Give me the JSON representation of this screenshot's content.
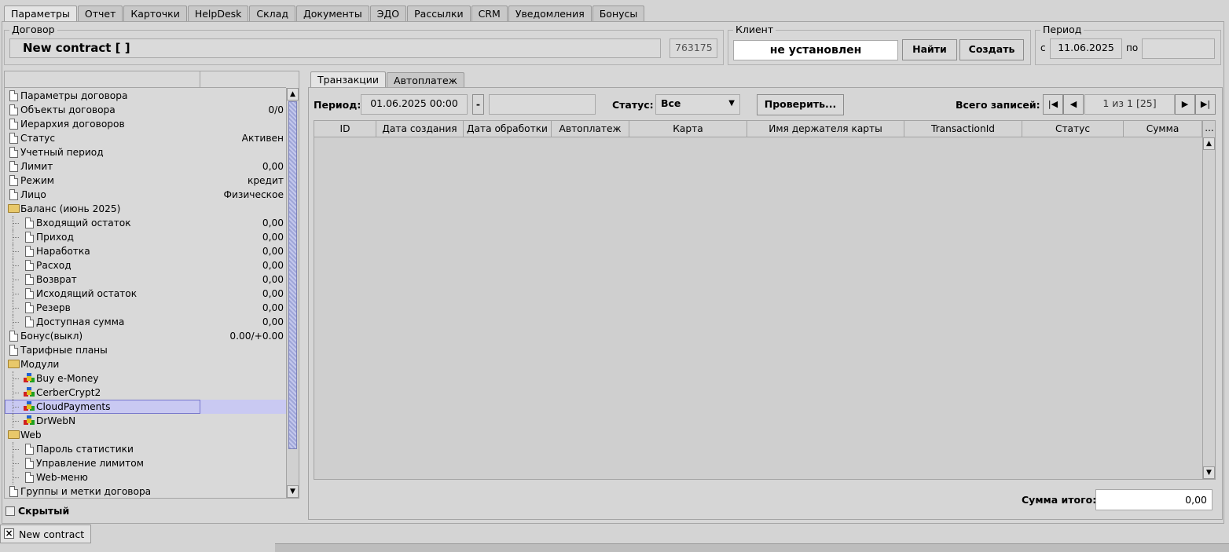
{
  "top_tabs": [
    "Параметры",
    "Отчет",
    "Карточки",
    "HelpDesk",
    "Склад",
    "Документы",
    "ЭДО",
    "Рассылки",
    "CRM",
    "Уведомления",
    "Бонусы"
  ],
  "contract": {
    "group_title": "Договор",
    "name": "New contract [  ]",
    "id": "763175"
  },
  "client": {
    "group_title": "Клиент",
    "value": "не установлен",
    "find_label": "Найти",
    "create_label": "Создать"
  },
  "period": {
    "group_title": "Период",
    "from_label": "с",
    "from_value": "11.06.2025",
    "to_label": "по",
    "to_value": ""
  },
  "tree": {
    "rows": [
      {
        "label": "Параметры договора",
        "value": "",
        "icon": "document-icon",
        "level": 0
      },
      {
        "label": "Объекты договора",
        "value": "0/0",
        "icon": "document-icon",
        "level": 0
      },
      {
        "label": "Иерархия договоров",
        "value": "",
        "icon": "document-icon",
        "level": 0
      },
      {
        "label": "Статус",
        "value": "Активен",
        "icon": "document-icon",
        "level": 0
      },
      {
        "label": "Учетный период",
        "value": "",
        "icon": "document-icon",
        "level": 0
      },
      {
        "label": "Лимит",
        "value": "0,00",
        "icon": "document-icon",
        "level": 0
      },
      {
        "label": "Режим",
        "value": "кредит",
        "icon": "document-icon",
        "level": 0
      },
      {
        "label": "Лицо",
        "value": "Физическое",
        "icon": "document-icon",
        "level": 0
      },
      {
        "label": "Баланс (июнь 2025)",
        "value": "",
        "icon": "folder-open-icon",
        "level": 0
      },
      {
        "label": "Входящий остаток",
        "value": "0,00",
        "icon": "document-icon",
        "level": 1
      },
      {
        "label": "Приход",
        "value": "0,00",
        "icon": "document-icon",
        "level": 1
      },
      {
        "label": "Наработка",
        "value": "0,00",
        "icon": "document-icon",
        "level": 1
      },
      {
        "label": "Расход",
        "value": "0,00",
        "icon": "document-icon",
        "level": 1
      },
      {
        "label": "Возврат",
        "value": "0,00",
        "icon": "document-icon",
        "level": 1
      },
      {
        "label": "Исходящий остаток",
        "value": "0,00",
        "icon": "document-icon",
        "level": 1
      },
      {
        "label": "Резерв",
        "value": "0,00",
        "icon": "document-icon",
        "level": 1
      },
      {
        "label": "Доступная сумма",
        "value": "0,00",
        "icon": "document-icon",
        "level": 1
      },
      {
        "label": "Бонус(выкл)",
        "value": "0.00/+0.00",
        "icon": "document-icon",
        "level": 0
      },
      {
        "label": "Тарифные планы",
        "value": "",
        "icon": "document-icon",
        "level": 0
      },
      {
        "label": "Модули",
        "value": "",
        "icon": "folder-open-icon",
        "level": 0
      },
      {
        "label": "Buy e-Money",
        "value": "",
        "icon": "module-icon",
        "level": 1
      },
      {
        "label": "CerberCrypt2",
        "value": "",
        "icon": "module-icon",
        "level": 1
      },
      {
        "label": "CloudPayments",
        "value": "",
        "icon": "module-icon",
        "level": 1,
        "selected": true
      },
      {
        "label": "DrWebN",
        "value": "",
        "icon": "module-icon",
        "level": 1
      },
      {
        "label": "Web",
        "value": "",
        "icon": "folder-open-icon",
        "level": 0
      },
      {
        "label": "Пароль статистики",
        "value": "",
        "icon": "document-icon",
        "level": 1
      },
      {
        "label": "Управление лимитом",
        "value": "",
        "icon": "document-icon",
        "level": 1
      },
      {
        "label": "Web-меню",
        "value": "",
        "icon": "document-icon",
        "level": 1
      },
      {
        "label": "Группы и метки договора",
        "value": "",
        "icon": "document-icon",
        "level": 0
      }
    ],
    "hidden_checkbox_label": "Скрытый"
  },
  "sub_tabs": [
    "Транзакции",
    "Автоплатеж"
  ],
  "filters": {
    "period_label": "Период:",
    "period_from": "01.06.2025 00:00",
    "dash": "-",
    "period_to": "",
    "status_label": "Статус:",
    "status_value": "Все",
    "check_label": "Проверить...",
    "total_label": "Всего записей: 0",
    "page_label": "1 из 1 [25]"
  },
  "table": {
    "columns": [
      "ID",
      "Дата создания",
      "Дата обработки",
      "Автоплатеж",
      "Карта",
      "Имя держателя карты",
      "TransactionId",
      "Статус",
      "Сумма"
    ],
    "more": "...",
    "rows": []
  },
  "sum_total": {
    "label": "Сумма итого:",
    "value": "0,00"
  },
  "bottom_tab": {
    "label": "New contract"
  },
  "colors": {
    "selection": "#c9c9f2",
    "scroll_thumb": "#9fa6d8"
  }
}
